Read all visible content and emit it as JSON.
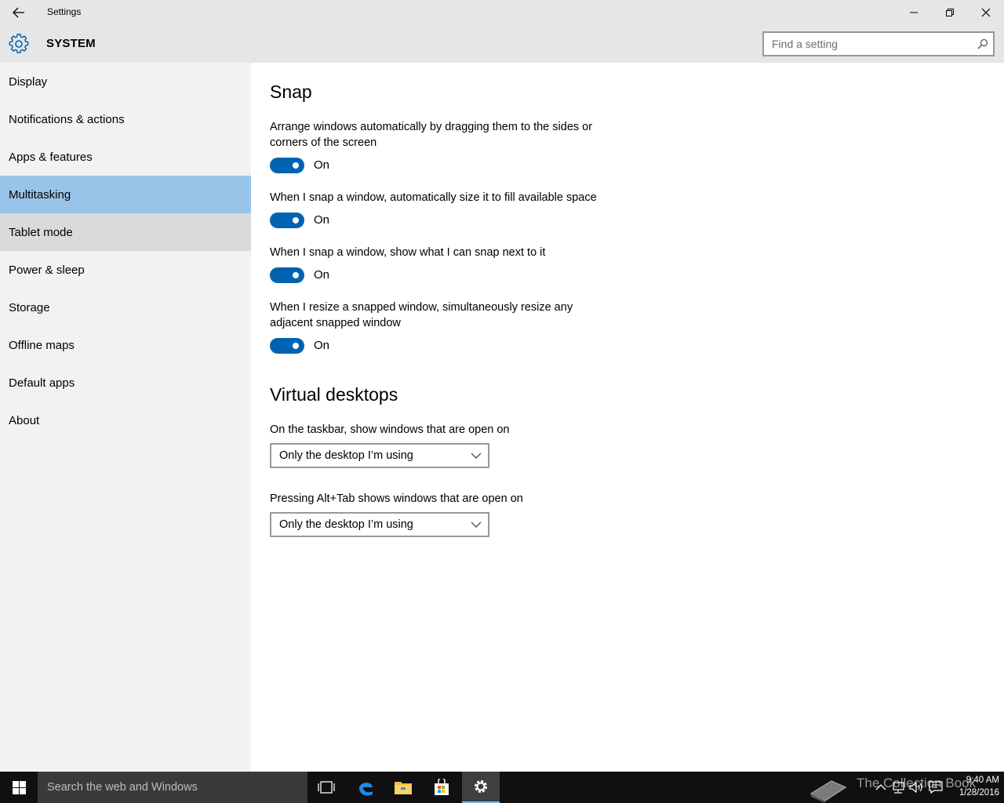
{
  "window": {
    "title": "Settings"
  },
  "header": {
    "title": "SYSTEM",
    "search_placeholder": "Find a setting"
  },
  "sidebar": {
    "items": [
      {
        "label": "Display"
      },
      {
        "label": "Notifications & actions"
      },
      {
        "label": "Apps & features"
      },
      {
        "label": "Multitasking"
      },
      {
        "label": "Tablet mode"
      },
      {
        "label": "Power & sleep"
      },
      {
        "label": "Storage"
      },
      {
        "label": "Offline maps"
      },
      {
        "label": "Default apps"
      },
      {
        "label": "About"
      }
    ],
    "selected": "Multitasking"
  },
  "snap": {
    "heading": "Snap",
    "settings": [
      {
        "description": "Arrange windows automatically by dragging them to the sides or corners of the screen",
        "state": "On"
      },
      {
        "description": "When I snap a window, automatically size it to fill available space",
        "state": "On"
      },
      {
        "description": "When I snap a window, show what I can snap next to it",
        "state": "On"
      },
      {
        "description": "When I resize a snapped window, simultaneously resize any adjacent snapped window",
        "state": "On"
      }
    ]
  },
  "virtual_desktops": {
    "heading": "Virtual desktops",
    "taskbar_label": "On the taskbar, show windows that are open on",
    "taskbar_value": "Only the desktop I’m using",
    "alttab_label": "Pressing Alt+Tab shows windows that are open on",
    "alttab_value": "Only the desktop I’m using"
  },
  "taskbar": {
    "search_placeholder": "Search the web and Windows",
    "watermark": "The Collection Book",
    "time": "9:40 AM",
    "date": "1/28/2016"
  },
  "colors": {
    "accent": "#0063b1",
    "selected_nav": "#99c4e9",
    "sidebar_bg": "#f2f2f2",
    "titlebar_bg": "#e6e6e6",
    "taskbar_bg": "#101010"
  }
}
